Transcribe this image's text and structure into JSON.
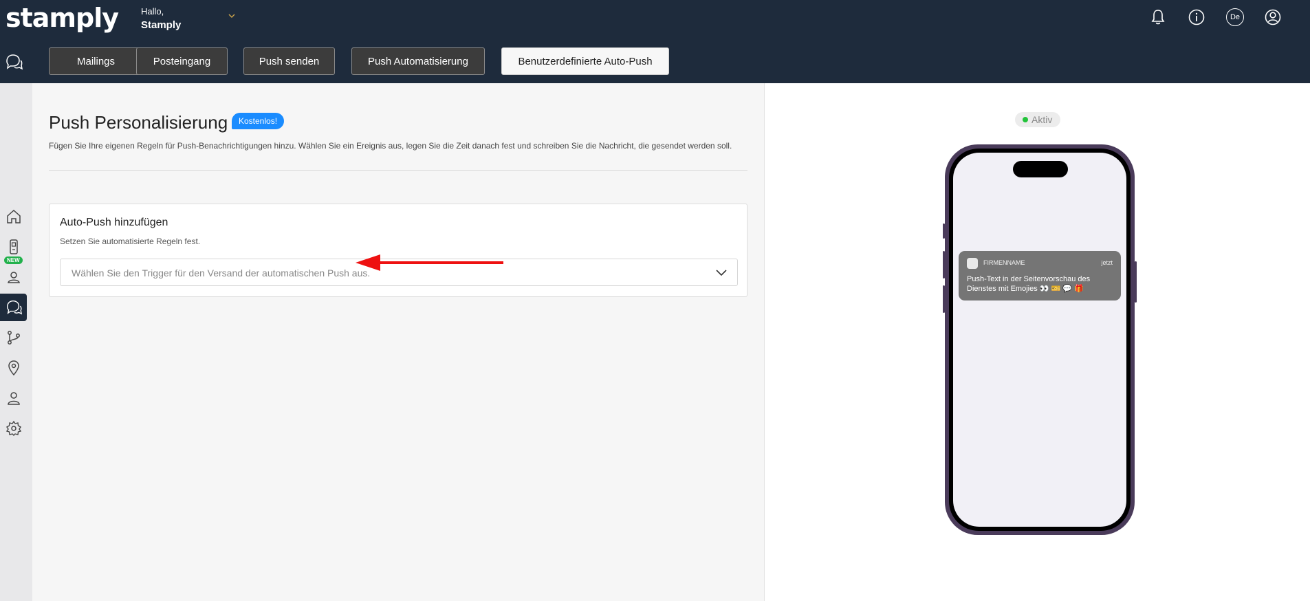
{
  "app": {
    "logo": "stamply",
    "greeting": "Hallo,",
    "user_name": "Stamply"
  },
  "header": {
    "icons": [
      "bell-icon",
      "info-icon",
      "language-icon",
      "user-icon"
    ],
    "language": "De"
  },
  "tabs": [
    {
      "label": "Mailings"
    },
    {
      "label": "Posteingang"
    },
    {
      "label": "Push senden"
    },
    {
      "label": "Push Automatisierung"
    },
    {
      "label": "Benutzerdefinierte Auto-Push"
    }
  ],
  "sidebar": {
    "new_badge": "NEW",
    "items": [
      "home-icon",
      "device-icon",
      "users-icon",
      "chat-icon",
      "flow-icon",
      "location-icon",
      "profile-icon",
      "settings-icon"
    ]
  },
  "main": {
    "title": "Push Personalisierung",
    "badge": "Kostenlos!",
    "subtitle": "Fügen Sie Ihre eigenen Regeln für Push-Benachrichtigungen hinzu. Wählen Sie ein Ereignis aus, legen Sie die Zeit danach fest und schreiben Sie die Nachricht, die gesendet werden soll.",
    "card": {
      "title": "Auto-Push hinzufügen",
      "subtitle": "Setzen Sie automatisierte Regeln fest.",
      "select_placeholder": "Wählen Sie den Trigger für den Versand der automatischen Push aus."
    }
  },
  "preview": {
    "status": "Aktiv",
    "status_color": "#22c33a",
    "notification": {
      "app": "FIRMENNAME",
      "time": "jetzt",
      "body": "Push-Text in der Seitenvorschau des Dienstes mit Emojies 👀 🎫 💬 🎁"
    }
  },
  "colors": {
    "header_bg": "#1e2b3c",
    "badge_blue": "#1a8cff",
    "arrow_red": "#ee1111"
  }
}
